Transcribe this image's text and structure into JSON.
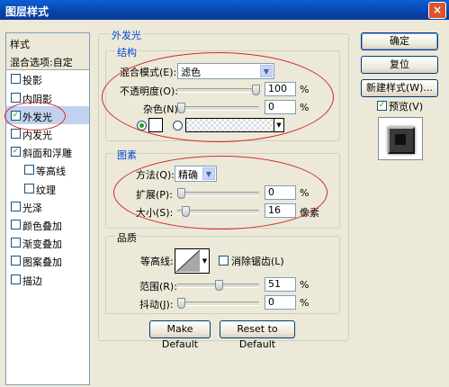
{
  "window": {
    "title": "图层样式",
    "close_glyph": "×"
  },
  "sidebar": {
    "items": [
      {
        "label": "样式",
        "type": "header"
      },
      {
        "label": "混合选项:自定",
        "type": "header"
      },
      {
        "label": "投影",
        "checked": false
      },
      {
        "label": "内阴影",
        "checked": false
      },
      {
        "label": "外发光",
        "checked": true,
        "selected": true
      },
      {
        "label": "内发光",
        "checked": false
      },
      {
        "label": "斜面和浮雕",
        "checked": true
      },
      {
        "label": "等高线",
        "checked": false,
        "sub": true
      },
      {
        "label": "纹理",
        "checked": false,
        "sub": true
      },
      {
        "label": "光泽",
        "checked": false
      },
      {
        "label": "颜色叠加",
        "checked": false
      },
      {
        "label": "渐变叠加",
        "checked": false
      },
      {
        "label": "图案叠加",
        "checked": false
      },
      {
        "label": "描边",
        "checked": false
      }
    ]
  },
  "outer_glow": {
    "title": "外发光",
    "structure": {
      "title": "结构",
      "blend_mode_label": "混合模式(E):",
      "blend_mode_value": "滤色",
      "opacity_label": "不透明度(O):",
      "opacity_value": "100",
      "opacity_unit": "%",
      "opacity_level": 1.0,
      "noise_label": "杂色(N):",
      "noise_value": "0",
      "noise_unit": "%",
      "noise_level": 0.0,
      "color_swatch": "#ffffff"
    },
    "elements": {
      "title": "图素",
      "technique_label": "方法(Q):",
      "technique_value": "精确",
      "spread_label": "扩展(P):",
      "spread_value": "0",
      "spread_unit": "%",
      "spread_level": 0.0,
      "size_label": "大小(S):",
      "size_value": "16",
      "size_unit": "像素",
      "size_level": 0.06
    },
    "quality": {
      "title": "品质",
      "contour_label": "等高线:",
      "anti_alias_label": "消除锯齿(L)",
      "anti_alias_checked": false,
      "range_label": "范围(R):",
      "range_value": "51",
      "range_unit": "%",
      "range_level": 0.51,
      "jitter_label": "抖动(J):",
      "jitter_value": "0",
      "jitter_unit": "%",
      "jitter_level": 0.0
    },
    "make_default_label": "Make Default",
    "reset_default_label": "Reset to Default"
  },
  "right_panel": {
    "ok_label": "确定",
    "reset_label": "复位",
    "new_style_label": "新建样式(W)...",
    "preview_label": "预览(V)",
    "preview_checked": true
  },
  "colors": {
    "annotation": "#d22b2b",
    "accent": "#0046d5"
  }
}
